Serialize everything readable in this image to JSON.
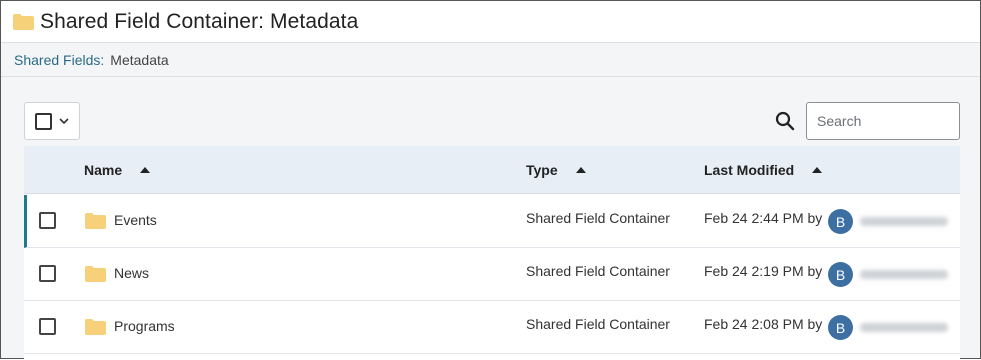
{
  "header": {
    "title": "Shared Field Container: Metadata",
    "icon": "folder-icon"
  },
  "breadcrumb": {
    "parent": "Shared Fields",
    "separator": ":",
    "current": "Metadata"
  },
  "toolbar": {
    "search_placeholder": "Search",
    "search_icon": "search-icon"
  },
  "table": {
    "columns": [
      {
        "label": "Name",
        "sort": "ascending"
      },
      {
        "label": "Type",
        "sort": "ascending"
      },
      {
        "label": "Last Modified",
        "sort": "ascending"
      }
    ],
    "rows": [
      {
        "name": "Events",
        "type": "Shared Field Container",
        "modified": "Feb 24 2:44 PM by",
        "avatar": "B",
        "active": true
      },
      {
        "name": "News",
        "type": "Shared Field Container",
        "modified": "Feb 24 2:19 PM by",
        "avatar": "B",
        "active": false
      },
      {
        "name": "Programs",
        "type": "Shared Field Container",
        "modified": "Feb 24 2:08 PM by",
        "avatar": "B",
        "active": false
      }
    ]
  },
  "colors": {
    "accent": "#1f7a8c",
    "link": "#2b6a86",
    "avatar": "#3d6fa3",
    "folder": "#f7d07a",
    "header_bg": "#e8eef6"
  }
}
